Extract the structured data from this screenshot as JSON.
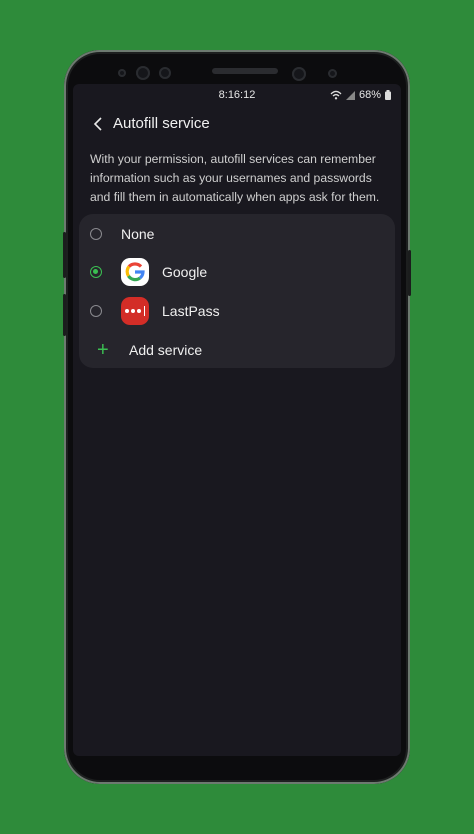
{
  "status": {
    "time": "8:16:12",
    "battery": "68%"
  },
  "header": {
    "title": "Autofill service"
  },
  "description": "With your permission, autofill services can remember information such as your usernames and passwords and fill them in automatically when apps ask for them.",
  "options": [
    {
      "label": "None",
      "selected": false
    },
    {
      "label": "Google",
      "selected": true,
      "icon": "google-icon"
    },
    {
      "label": "LastPass",
      "selected": false,
      "icon": "lastpass-icon"
    }
  ],
  "add_service": {
    "label": "Add service",
    "icon": "plus-icon"
  },
  "colors": {
    "background": "#2e8b3a",
    "screen": "#19181f",
    "card": "#26252c",
    "accent": "#3bbf52"
  }
}
